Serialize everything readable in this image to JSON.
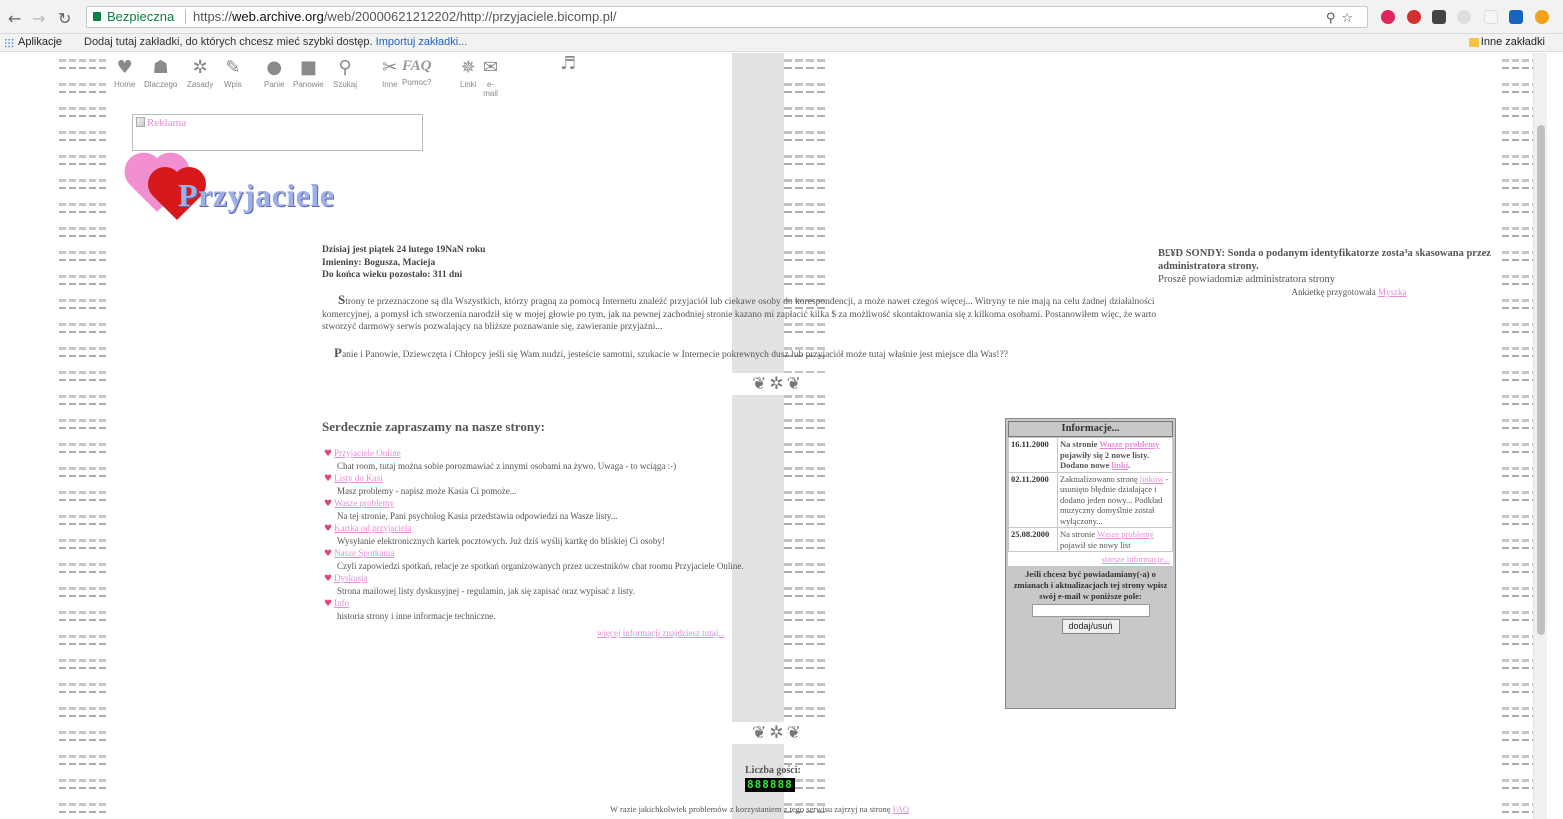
{
  "browser": {
    "secure_label": "Bezpieczna",
    "url_prefix": "https://",
    "url_host": "web.archive.org",
    "url_path": "/web/20000621212202/http://przyjaciele.bicomp.pl/"
  },
  "bookmarks": {
    "apps_label": "Aplikacje",
    "hint": "Dodaj tutaj zakładki, do których chcesz mieć szybki dostęp.",
    "import_link": "Importuj zakładki...",
    "other_label": "Inne zakładki"
  },
  "nav": [
    {
      "label": "Home",
      "icon": "heart-icon"
    },
    {
      "label": "Dlaczego",
      "icon": "people-icon"
    },
    {
      "label": "Zasady",
      "icon": "gear-icon"
    },
    {
      "label": "Wpis",
      "icon": "pen-icon"
    },
    {
      "label": "Panie",
      "icon": "circle-icon"
    },
    {
      "label": "Panowie",
      "icon": "square-icon"
    },
    {
      "label": "Szukaj",
      "icon": "magnifier-icon"
    },
    {
      "label": "Inne",
      "icon": "tools-icon"
    },
    {
      "label": "Pomoc?",
      "icon": "faq-icon",
      "glyph": "FAQ"
    },
    {
      "label": "Linki",
      "icon": "link-icon"
    },
    {
      "label": "e-mail",
      "icon": "envelope-icon"
    }
  ],
  "ad": {
    "alt": "Reklama"
  },
  "logo": {
    "text": "Przyjaciele"
  },
  "today": {
    "line1": "Dzisiaj jest piątek 24 lutego 19NaN roku",
    "line2": "Imieniny: Bogusza, Macieja",
    "line3": "Do końca wieku pozostało: 311 dni"
  },
  "intro": {
    "p1_cap": "S",
    "p1_rest": "trony te przeznaczone są dla Wszystkich, którzy pragną za pomocą Internetu znaleźć przyjaciół lub ciekawe osoby do korespondencji, a może nawet czegoś więcej... Witryny te nie mają na celu żadnej działalności komercyjnej, a pomysł ich stworzenia narodził się w mojej głowie po tym, jak na pewnej zachodniej stronie kazano mi zapłacić kilka $ za możliwość skontaktowania się z kilkoma osobami. Postanowiłem więc, że warto stworzyć darmowy serwis pozwalający na bliższe poznawanie się, zawieranie przyjaźni...",
    "p2_cap": "P",
    "p2_rest": "anie i Panowie, Dziewczęta i Chłopcy jeśli się Wam nudzi, jesteście samotni, szukacie w Internecie pokrewnych dusz lub przyjaciół może tutaj właśnie jest miejsce dla Was!??"
  },
  "invite": {
    "title": "Serdecznie zapraszamy na nasze strony:",
    "items": [
      {
        "link": "Przyjaciele Online",
        "desc": "Chat room, tutaj można sobie porozmawiać z innymi osobami na żywo. Uwaga - to wciąga :-)"
      },
      {
        "link": "Listy do Kasi",
        "desc": "Masz problemy - napisz może Kasia Ci pomoże..."
      },
      {
        "link": "Wasze problemy",
        "desc": "Na tej stronie, Pani psycholog Kasia przedstawia odpowiedzi na Wasze listy..."
      },
      {
        "link": "Kartka od przyjaciela",
        "desc": "Wysyłanie elektronicznych kartek pocztowych. Już dziś wyślij kartkę do bliskiej Ci osoby!"
      },
      {
        "link": "Nasze Spotkania",
        "desc": "Czyli zapowiedzi spotkań, relacje ze spotkań organizowanych przez uczestników chat roomu Przyjaciele Online."
      },
      {
        "link": "Dyskusja",
        "desc": "Strona mailowej listy dyskusyjnej - regulamin, jak się zapisać oraz wypisać z listy."
      },
      {
        "link": "Info",
        "desc": "historia strony  i inne informacje techniczne."
      }
    ],
    "more": "więcej informacji znajdziesz tutaj..."
  },
  "sonda": {
    "error": "B£¥D SONDY: Sonda o podanym identyfikatorze zosta³a skasowana przez administratora strony.",
    "notice": "Proszê powiadomiæ administratora strony",
    "by": "Ankietkę przygotowała",
    "by_link": "Myszka"
  },
  "info": {
    "title": "Informacje...",
    "entries": [
      {
        "date": "16.11.2000",
        "t1": "Na stronie ",
        "link1": "Wasze problemy",
        "t2": " pojawiły się 2 nowe listy. Dodano nowe ",
        "link2": "linki",
        "t3": "."
      },
      {
        "date": "02.11.2000",
        "t1": "Zaktualizowano stronę ",
        "link1": "linków",
        "t2": " - usunięto błędnie działające i dodano jeden nowy... Podkład muzyczny domyślnie został wyłączony...",
        "link2": "",
        "t3": ""
      },
      {
        "date": "25.08.2000",
        "t1": "Na stronie ",
        "link1": "Wasze problemy",
        "t2": " pojawił sie nowy list",
        "link2": "",
        "t3": ""
      }
    ],
    "older": "starsze informacje...",
    "notify": "Jeśli chcesz być powiadamiany(-a) o zmianach i aktualizacjach tej strony wpisz swój e-mail w poniższe pole:",
    "email_value": "",
    "button": "dodaj/usuń"
  },
  "counter": {
    "label": "Liczba gości:",
    "value": "888888"
  },
  "footer": {
    "text": "W razie jakichkolwiek problemów z korzystaniem z tego serwisu zajrzyj na stronę ",
    "link": "FAQ"
  }
}
